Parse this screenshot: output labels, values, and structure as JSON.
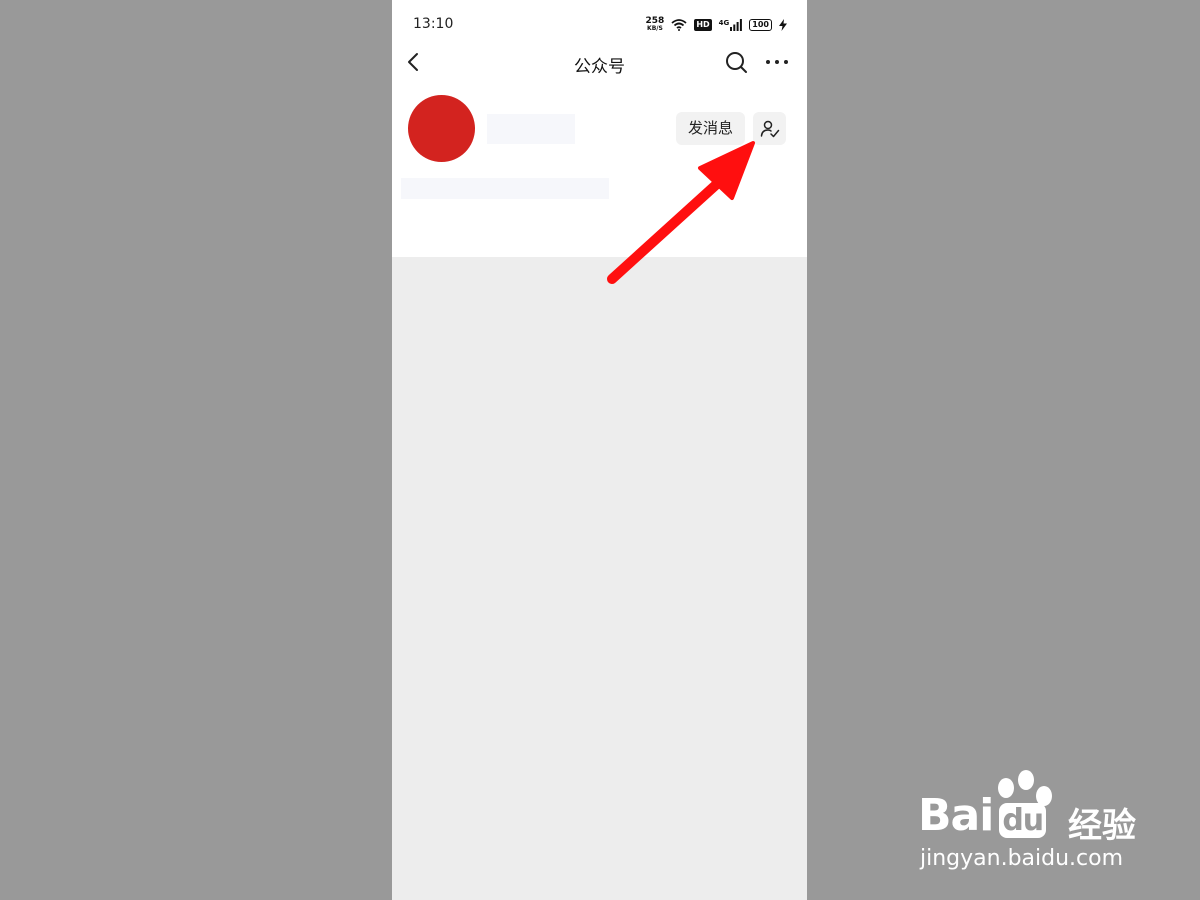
{
  "status_bar": {
    "time": "13:10",
    "speed_value": "258",
    "speed_unit": "KB/S",
    "hd": "HD",
    "network": "4G",
    "battery": "100"
  },
  "nav": {
    "title": "公众号",
    "back_icon": "chevron-left-icon",
    "search_icon": "search-icon",
    "more_icon": "more-dots-icon"
  },
  "profile": {
    "avatar_color": "#d3231f",
    "send_message_label": "发消息",
    "sign_icon": "signature-icon"
  },
  "annotation": {
    "arrow_color": "#ff0000"
  },
  "watermark": {
    "brand": "Bai",
    "brand_du": "du",
    "product": "经验",
    "url": "jingyan.baidu.com"
  }
}
